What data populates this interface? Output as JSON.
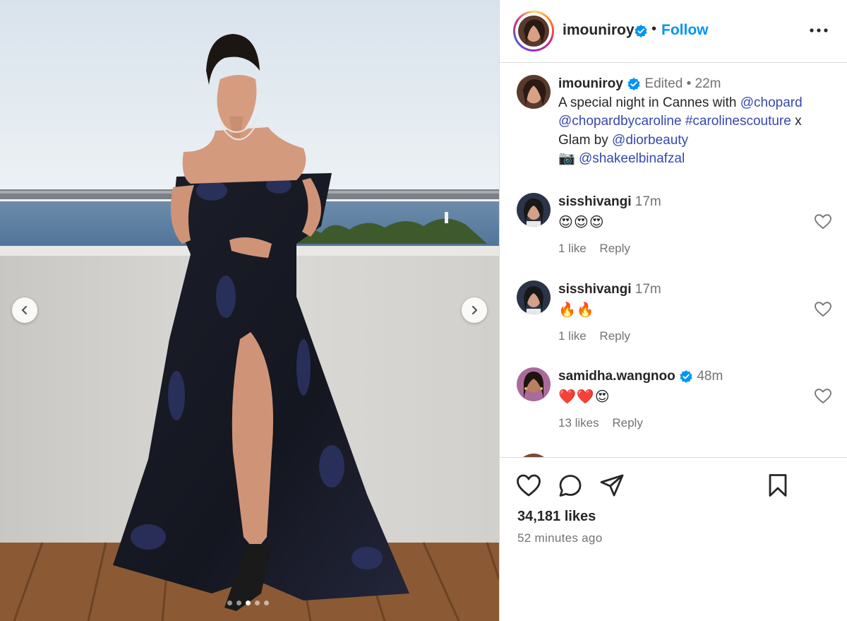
{
  "post": {
    "username": "imouniroy",
    "follow_label": "Follow",
    "separator": "•",
    "more_label": "•••",
    "caption": {
      "username": "imouniroy",
      "edited_label": "Edited",
      "dot": "•",
      "time": "22m",
      "text_1": "A special night in Cannes with ",
      "mention_chopard": "@chopard",
      "mention_caroline": "@chopardbycaroline",
      "hashtag": "#carolinescouture",
      "text_x": " x",
      "text_glam": "Glam by ",
      "mention_dior": "@diorbeauty",
      "camera_emoji": "📷",
      "mention_photographer": "@shakeelbinafzal"
    },
    "comments": [
      {
        "username": "sisshivangi",
        "verified": false,
        "time": "17m",
        "text": "😍😍😍",
        "likes": "1 like",
        "reply": "Reply"
      },
      {
        "username": "sisshivangi",
        "verified": false,
        "time": "17m",
        "text": "🔥🔥",
        "likes": "1 like",
        "reply": "Reply"
      },
      {
        "username": "samidha.wangnoo",
        "verified": true,
        "time": "48m",
        "text": "❤️❤️😍",
        "likes": "13 likes",
        "reply": "Reply"
      }
    ],
    "likes_count": "34,181 likes",
    "posted_time": "52 minutes ago",
    "carousel": {
      "total": 5,
      "active_index": 2
    }
  },
  "colors": {
    "link": "#3548b0",
    "follow": "#0095f6",
    "verified": "#0095f6",
    "muted": "#737373"
  },
  "icons": {
    "prev": "chevron-left-icon",
    "next": "chevron-right-icon",
    "like": "heart-icon",
    "comment": "comment-icon",
    "share": "paper-plane-icon",
    "save": "bookmark-icon",
    "more": "more-horizontal-icon",
    "verified": "verified-badge-icon"
  }
}
